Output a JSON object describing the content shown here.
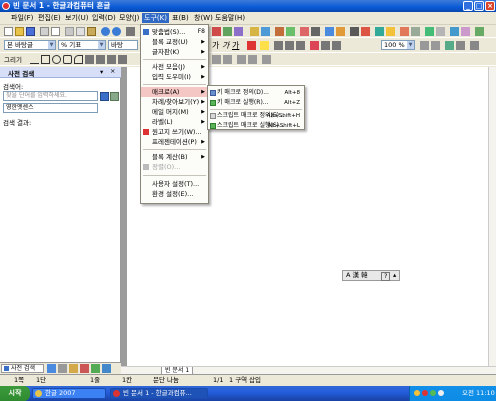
{
  "window": {
    "title": "빈 문서 1 - 한글과컴퓨터 흔글",
    "minimize": "_",
    "maximize": "□",
    "close": "×"
  },
  "menubar": {
    "items": [
      "파일(F)",
      "편집(E)",
      "보기(U)",
      "입력(D)",
      "모양(J)",
      "도구(K)",
      "표(B)",
      "창(W)",
      "도움말(H)"
    ],
    "active_index": 5
  },
  "toolbar": {
    "style_combo": "본 바탕글",
    "font_size_combo": "% 기표",
    "font_combo": "바탕",
    "zoom_combo": "100 %",
    "row3_label": "그리기"
  },
  "tools_menu": {
    "items": [
      {
        "label": "맞춤법(S)...",
        "hotkey": "F8",
        "submenu": false
      },
      {
        "label": "블록 교정(U)",
        "submenu": true
      },
      {
        "label": "글자판(K)",
        "submenu": true
      },
      {
        "label": "사전 모음(J)",
        "submenu": true
      },
      {
        "label": "입력 도우미(I)",
        "submenu": true
      },
      {
        "label": "매크로(A)",
        "submenu": true,
        "highlighted": true
      },
      {
        "label": "차례/찾아보기(Y)",
        "submenu": true
      },
      {
        "label": "메일 머지(M)",
        "submenu": true
      },
      {
        "label": "라벨(L)",
        "submenu": true
      },
      {
        "label": "원고지 쓰기(W)...",
        "submenu": false
      },
      {
        "label": "프레젠테이션(P)",
        "submenu": true
      },
      {
        "label": "블록 계산(B)",
        "submenu": true
      },
      {
        "label": "정렬(O)...",
        "submenu": false,
        "disabled": true
      },
      {
        "label": "사용자 설정(T)...",
        "submenu": false
      },
      {
        "label": "환경 설정(E)...",
        "submenu": false
      }
    ]
  },
  "macro_submenu": {
    "items": [
      {
        "label": "키 매크로 정의(D)...",
        "hotkey": "Alt+8"
      },
      {
        "label": "키 매크로 실행(R)...",
        "hotkey": "Alt+Z"
      },
      {
        "label": "스크립트 매크로 정의(E)...",
        "hotkey": "Alt+Shift+H"
      },
      {
        "label": "스크립트 매크로 실행(S)...",
        "hotkey": "Alt+Shift+L"
      }
    ]
  },
  "side_panel": {
    "title": "사전 검색",
    "search_label": "검색어:",
    "search_placeholder": "찾을 단어를 입력하세요.",
    "dict_select": "영한엣센스",
    "result_label": "검색 결과:",
    "tab_label": "사전 검색"
  },
  "document": {
    "sheet_tab": "빈 문서 1"
  },
  "ime_bar": {
    "mode": "A 漢 韓",
    "help": "?"
  },
  "statusbar": {
    "page": "1쪽",
    "section": "1단",
    "line": "1줄",
    "column": "1칸",
    "mode1": "문단 나눔",
    "pages": "1/1",
    "region": "1 구역",
    "insert": "삽입"
  },
  "taskbar": {
    "start": "시작",
    "items": [
      "한글 2007",
      "빈 문서 1 - 한글과컴퓨..."
    ],
    "clock": "오전 11:10"
  }
}
